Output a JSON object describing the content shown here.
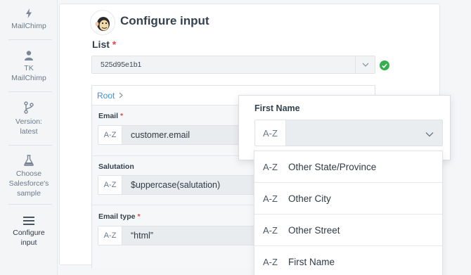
{
  "sidebar": {
    "items": [
      {
        "label": "MailChimp",
        "icon": "bolt-icon"
      },
      {
        "label": "TK MailChimp",
        "icon": "user-icon"
      },
      {
        "label": "Version: latest",
        "icon": "branch-icon"
      },
      {
        "label": "Choose Salesforce's sample",
        "icon": "flask-icon"
      },
      {
        "label": "Configure input",
        "icon": "menu-icon"
      }
    ]
  },
  "header": {
    "title": "Configure input"
  },
  "list": {
    "label": "List",
    "required_mark": "*",
    "value": "525d95e1b1"
  },
  "mapping": {
    "breadcrumb": "Root",
    "fields": [
      {
        "label": "Email",
        "required_mark": "*",
        "type_badge": "A-Z",
        "value": "customer.email"
      },
      {
        "label": "Salutation",
        "required_mark": "",
        "type_badge": "A-Z",
        "value": "$uppercase(salutation)"
      },
      {
        "label": "Email type",
        "required_mark": "*",
        "type_badge": "A-Z",
        "value": "“html”"
      }
    ]
  },
  "popover": {
    "label": "First Name",
    "type_badge": "A-Z",
    "value": "",
    "options": [
      {
        "badge": "A-Z",
        "name": "Other State/Province"
      },
      {
        "badge": "A-Z",
        "name": "Other City"
      },
      {
        "badge": "A-Z",
        "name": "Other Street"
      },
      {
        "badge": "A-Z",
        "name": "First Name"
      }
    ]
  },
  "colors": {
    "accent_link": "#3f8fd6",
    "required": "#e14848",
    "success": "#36b04c"
  }
}
